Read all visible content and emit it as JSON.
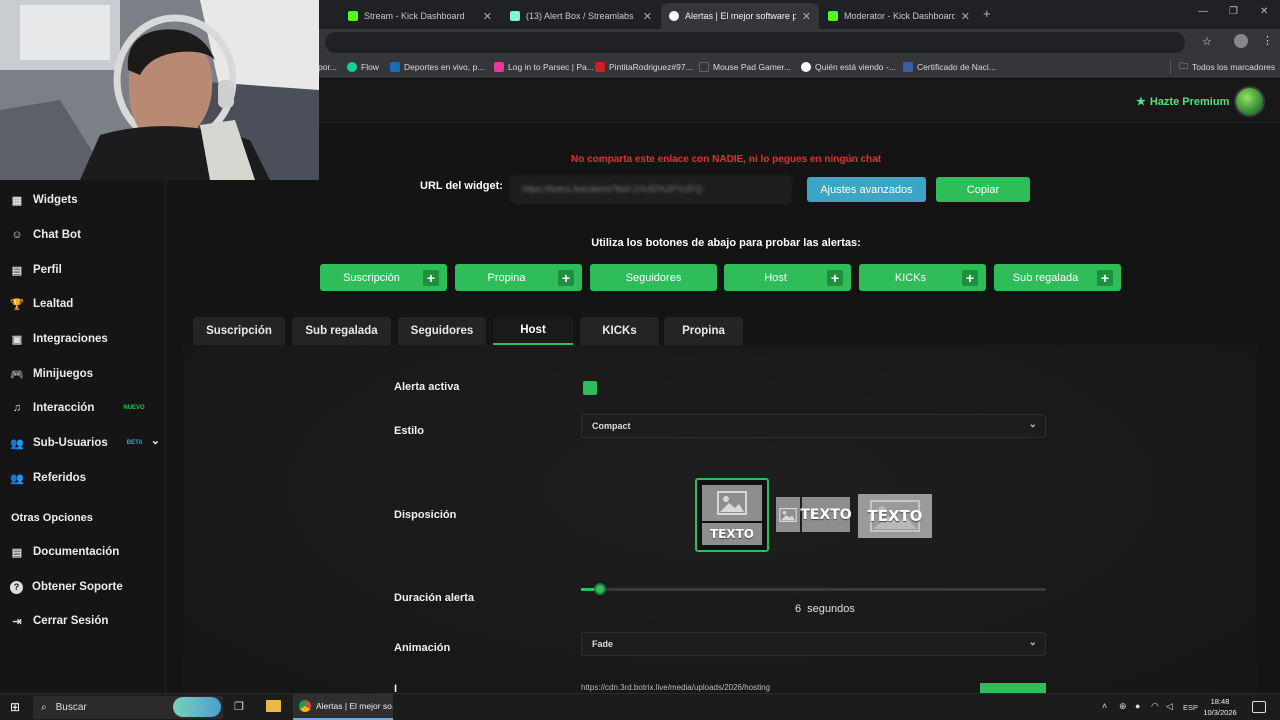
{
  "browser": {
    "tabs": [
      {
        "label": "Stream - Kick Dashboard",
        "favicon_color": "#53fc18",
        "active": false
      },
      {
        "label": "(13) Alert Box / Streamlabs",
        "favicon_color": "#80f5d2",
        "active": false
      },
      {
        "label": "Alertas | El mejor software para",
        "favicon_color": "#ffffff",
        "active": true
      },
      {
        "label": "Moderator - Kick Dashboard",
        "favicon_color": "#53fc18",
        "active": false
      }
    ],
    "new_tab": "+",
    "bookmarks": [
      {
        "label": "por...",
        "icon_color": "#4a4a4a"
      },
      {
        "label": "Flow",
        "icon_color": "#14d2a0"
      },
      {
        "label": "Deportes en vivo, p...",
        "icon_color": "#1b6bb8"
      },
      {
        "label": "Log in to Parsec | Pa...",
        "icon_color": "#e63aa0"
      },
      {
        "label": "PintitaRodriguez#97...",
        "icon_color": "#d11d1d"
      },
      {
        "label": "Mouse Pad Gamer...",
        "icon_color": "#333333"
      },
      {
        "label": "Quién está viendo -...",
        "icon_color": "#ffffff"
      },
      {
        "label": "Certificado de Naci...",
        "icon_color": "#3a5ea8"
      }
    ],
    "all_bookmarks": "Todos los marcadores"
  },
  "header": {
    "premium": "Hazte Premium",
    "premium_icon": "star-icon"
  },
  "sidebar": {
    "items": [
      {
        "label": "Widgets",
        "icon": "▦"
      },
      {
        "label": "Chat Bot",
        "icon": "☺"
      },
      {
        "label": "Perfil",
        "icon": "▤"
      },
      {
        "label": "Lealtad",
        "icon": "🏆"
      },
      {
        "label": "Integraciones",
        "icon": "▣"
      },
      {
        "label": "Minijuegos",
        "icon": "🎮"
      },
      {
        "label": "Interacción",
        "icon": "♫",
        "badge": "NUEVO",
        "badge_color": "#2fbd59"
      },
      {
        "label": "Sub-Usuarios",
        "icon": "👥",
        "badge": "BETA",
        "badge_color": "#3ba5c3",
        "expand": "⌄"
      },
      {
        "label": "Referidos",
        "icon": "👥"
      }
    ],
    "other_heading": "Otras Opciones",
    "other_items": [
      {
        "label": "Documentación",
        "icon": "▤"
      },
      {
        "label": "Obtener Soporte",
        "icon": "?"
      },
      {
        "label": "Cerrar Sesión",
        "icon": "⇥"
      }
    ]
  },
  "main": {
    "warning": "No comparta este enlace con NADIE, ni lo pegues en ningún chat",
    "url_label": "URL del widget:",
    "url_value": "https://botrix.live/alerts?bid=1%3D%2F%2FQ",
    "advanced_button": "Ajustes avanzados",
    "copy_button": "Copiar",
    "test_hint": "Utiliza los botones de abajo para probar las alertas:",
    "test_buttons": [
      {
        "label": "Suscripción",
        "plus": true
      },
      {
        "label": "Propina",
        "plus": true
      },
      {
        "label": "Seguidores",
        "plus": false
      },
      {
        "label": "Host",
        "plus": true
      },
      {
        "label": "KICKs",
        "plus": true
      },
      {
        "label": "Sub regalada",
        "plus": true
      }
    ],
    "tabs": [
      {
        "label": "Suscripción",
        "active": false
      },
      {
        "label": "Sub regalada",
        "active": false
      },
      {
        "label": "Seguidores",
        "active": false
      },
      {
        "label": "Host",
        "active": true
      },
      {
        "label": "KICKs",
        "active": false
      },
      {
        "label": "Propina",
        "active": false
      }
    ],
    "form": {
      "active_label": "Alerta activa",
      "active_checked": true,
      "style_label": "Estilo",
      "style_value": "Compact",
      "layout_label": "Disposición",
      "layout_text": "TEXTO",
      "layout_selected": 0,
      "duration_label": "Duración alerta",
      "duration_value": 6,
      "duration_display": "6",
      "duration_unit": "segundos",
      "duration_fraction": 0.04,
      "animation_label": "Animación",
      "animation_value": "Fade",
      "next_label": "I",
      "next_value": "https://cdn.3rd.botrix.live/media/uploads/2026/hosting"
    }
  },
  "taskbar": {
    "search_placeholder": "Buscar",
    "chrome_label": "Alertas | El mejor so...",
    "lang": "ESP",
    "time": "18:48",
    "date": "10/3/2026"
  },
  "colors": {
    "accent": "#2fbd59",
    "info": "#3ba5c3",
    "danger": "#e52e2e",
    "premium": "#52e27f"
  }
}
